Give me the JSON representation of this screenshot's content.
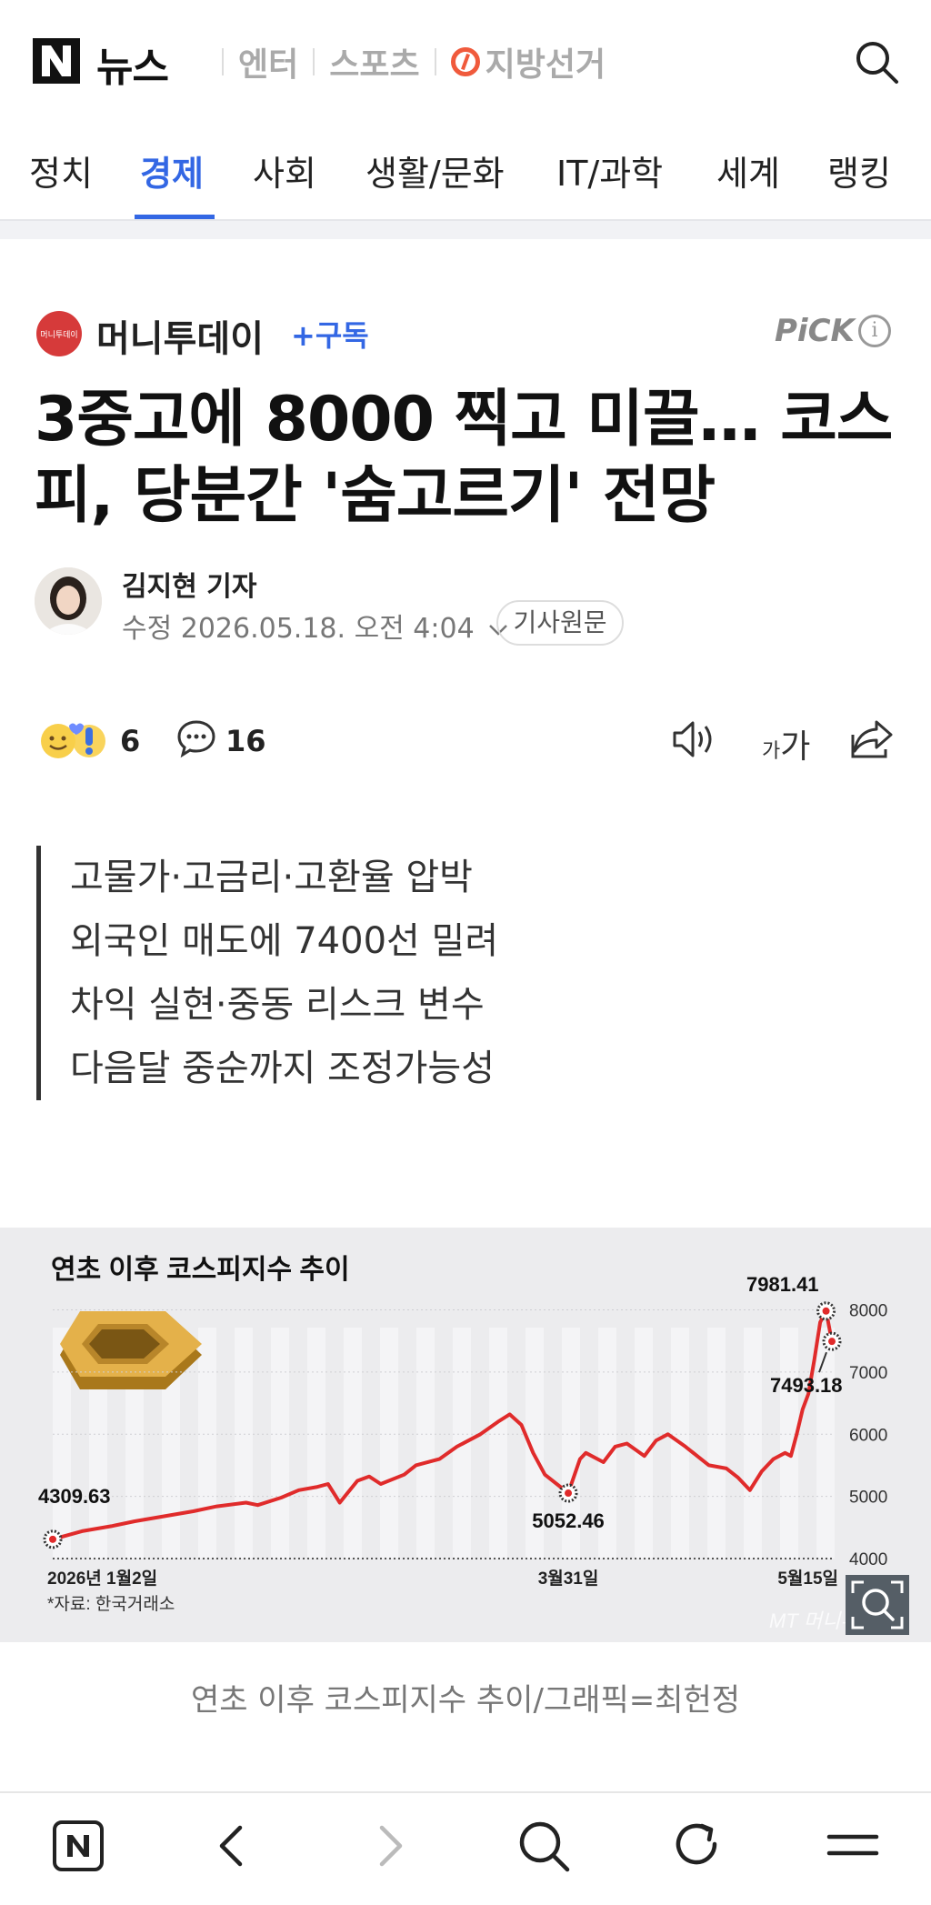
{
  "header": {
    "brand": "뉴스",
    "sections": [
      "엔터",
      "스포츠",
      "지방선거"
    ]
  },
  "categories": {
    "tabs": [
      "정치",
      "경제",
      "사회",
      "생활/문화",
      "IT/과학",
      "세계",
      "랭킹"
    ],
    "active": "경제"
  },
  "press": {
    "name": "머니투데이",
    "logo_text": "머니투데이",
    "subscribe_label": "+구독",
    "pick_label": "PiCK"
  },
  "article": {
    "title": "3중고에 8000 찍고 미끌… 코스피, 당분간 '숨고르기' 전망",
    "reporter": "김지현 기자",
    "dateline": "수정 2026.05.18. 오전 4:04",
    "origin_label": "기사원문",
    "reaction_count": "6",
    "comment_count": "16",
    "font_size_label_small": "가",
    "font_size_label_large": "가",
    "summary": [
      "고물가·고금리·고환율 압박",
      "외국인 매도에 7400선 밀려",
      "차익 실현·중동 리스크 변수",
      "다음달 중순까지 조정가능성"
    ],
    "caption": "연초 이후 코스피지수 추이/그래픽=최헌정"
  },
  "chart_data": {
    "type": "line",
    "title": "연초 이후 코스피지수 추이",
    "source": "*자료: 한국거래소",
    "watermark": "MT 머니투데이",
    "x_tick_labels": [
      "2026년 1월2일",
      "3월31일",
      "5월15일"
    ],
    "y_tick_labels": [
      "4000",
      "5000",
      "6000",
      "7000",
      "8000"
    ],
    "ylim": [
      4000,
      8300
    ],
    "annotations": [
      {
        "label": "4309.63",
        "x": "2026-01-02",
        "y": 4309.63
      },
      {
        "label": "5052.46",
        "x": "2026-03-31",
        "y": 5052.46
      },
      {
        "label": "7981.41",
        "x": "2026-05-14",
        "y": 7981.41
      },
      {
        "label": "7493.18",
        "x": "2026-05-15",
        "y": 7493.18
      }
    ],
    "series": [
      {
        "color": "#e02b2b",
        "points": [
          [
            "2026-01-02",
            4309.63
          ],
          [
            "2026-01-07",
            4440
          ],
          [
            "2026-01-12",
            4520
          ],
          [
            "2026-01-16",
            4600
          ],
          [
            "2026-01-21",
            4680
          ],
          [
            "2026-01-26",
            4760
          ],
          [
            "2026-01-30",
            4840
          ],
          [
            "2026-02-04",
            4900
          ],
          [
            "2026-02-06",
            4860
          ],
          [
            "2026-02-10",
            4980
          ],
          [
            "2026-02-13",
            5100
          ],
          [
            "2026-02-16",
            5150
          ],
          [
            "2026-02-18",
            5200
          ],
          [
            "2026-02-20",
            4900
          ],
          [
            "2026-02-23",
            5250
          ],
          [
            "2026-02-25",
            5320
          ],
          [
            "2026-02-27",
            5200
          ],
          [
            "2026-03-03",
            5350
          ],
          [
            "2026-03-05",
            5500
          ],
          [
            "2026-03-09",
            5600
          ],
          [
            "2026-03-12",
            5800
          ],
          [
            "2026-03-16",
            6000
          ],
          [
            "2026-03-19",
            6200
          ],
          [
            "2026-03-21",
            6320
          ],
          [
            "2026-03-23",
            6150
          ],
          [
            "2026-03-25",
            5700
          ],
          [
            "2026-03-27",
            5350
          ],
          [
            "2026-03-31",
            5052.46
          ],
          [
            "2026-04-02",
            5600
          ],
          [
            "2026-04-03",
            5700
          ],
          [
            "2026-04-06",
            5550
          ],
          [
            "2026-04-08",
            5800
          ],
          [
            "2026-04-10",
            5850
          ],
          [
            "2026-04-13",
            5650
          ],
          [
            "2026-04-15",
            5900
          ],
          [
            "2026-04-17",
            6000
          ],
          [
            "2026-04-20",
            5800
          ],
          [
            "2026-04-22",
            5650
          ],
          [
            "2026-04-24",
            5500
          ],
          [
            "2026-04-27",
            5450
          ],
          [
            "2026-04-29",
            5300
          ],
          [
            "2026-05-01",
            5100
          ],
          [
            "2026-05-03",
            5400
          ],
          [
            "2026-05-05",
            5600
          ],
          [
            "2026-05-07",
            5700
          ],
          [
            "2026-05-08",
            5650
          ],
          [
            "2026-05-09",
            6000
          ],
          [
            "2026-05-10",
            6400
          ],
          [
            "2026-05-11",
            6650
          ],
          [
            "2026-05-12",
            7200
          ],
          [
            "2026-05-13",
            7800
          ],
          [
            "2026-05-14",
            7981.41
          ],
          [
            "2026-05-15",
            7493.18
          ]
        ]
      }
    ],
    "grid": true
  }
}
